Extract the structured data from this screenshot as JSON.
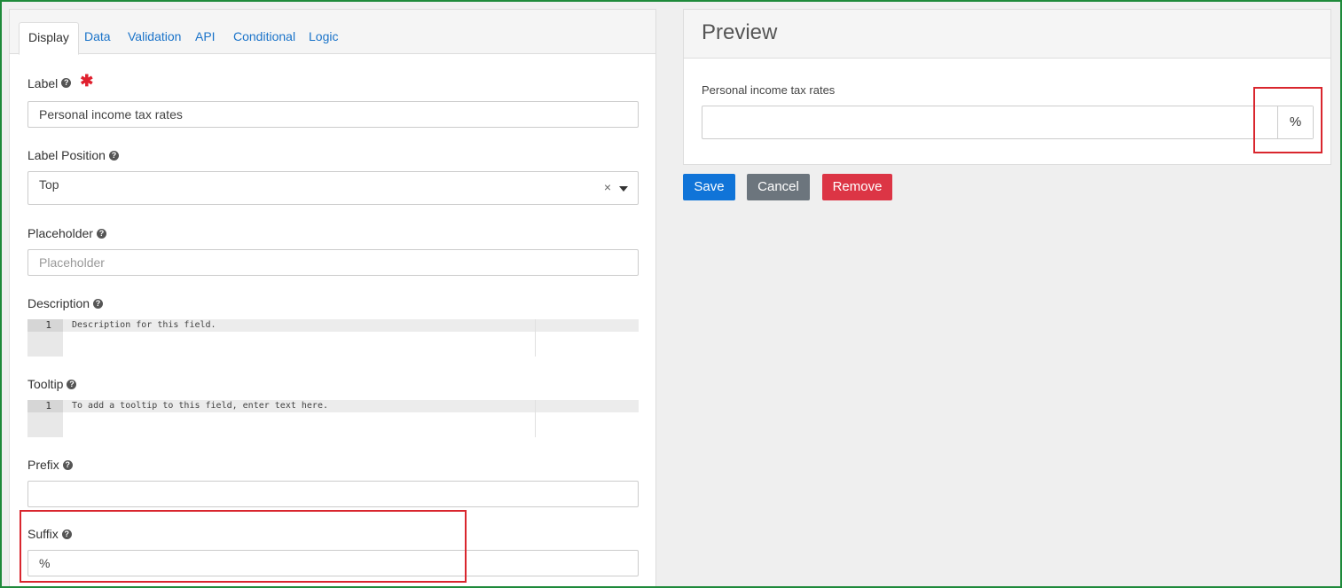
{
  "tabs": [
    {
      "label": "Display"
    },
    {
      "label": "Data"
    },
    {
      "label": "Validation"
    },
    {
      "label": "API"
    },
    {
      "label": "Conditional"
    },
    {
      "label": "Logic"
    }
  ],
  "fields": {
    "label": {
      "label": "Label",
      "required_mark": "✱",
      "value": "Personal income tax rates"
    },
    "label_position": {
      "label": "Label Position",
      "value": "Top",
      "clear": "×"
    },
    "placeholder": {
      "label": "Placeholder",
      "placeholder": "Placeholder"
    },
    "description": {
      "label": "Description",
      "line_number": "1",
      "text": "Description for this field."
    },
    "tooltip": {
      "label": "Tooltip",
      "line_number": "1",
      "text": "To add a tooltip to this field, enter text here."
    },
    "prefix": {
      "label": "Prefix",
      "value": ""
    },
    "suffix": {
      "label": "Suffix",
      "value": "%"
    }
  },
  "help_icon": {
    "glyph": "?",
    "icon": "question-circle-icon"
  },
  "preview": {
    "title": "Preview",
    "field_label": "Personal income tax rates",
    "suffix": "%"
  },
  "buttons": {
    "save": "Save",
    "cancel": "Cancel",
    "remove": "Remove"
  },
  "colors": {
    "accent": "#1074d8",
    "danger": "#dc3545",
    "secondary": "#6c757d",
    "highlight": "#d9262e",
    "frame": "#1e8a3a"
  }
}
